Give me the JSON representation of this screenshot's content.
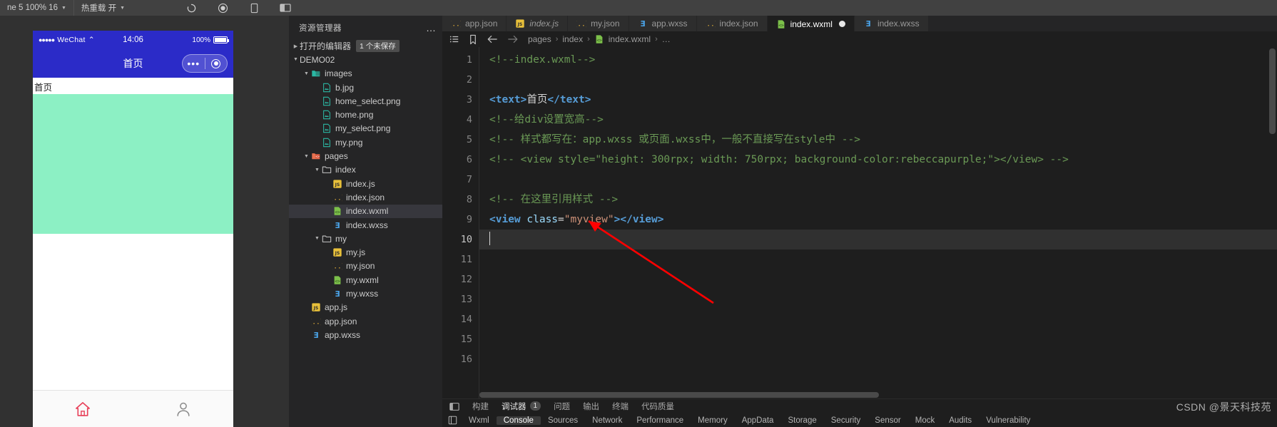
{
  "toolbar": {
    "segments": [
      {
        "name": "device-select",
        "label": "ne 5 100% 16",
        "caret": "▼"
      },
      {
        "name": "hot-reload",
        "label": "热重载 开",
        "caret": "▼"
      }
    ],
    "icons": [
      "refresh-icon",
      "record-icon",
      "mobile-preview-icon",
      "split-panel-icon"
    ]
  },
  "simulator": {
    "status_bar": {
      "carrier": "WeChat",
      "signal_dots": "●●●●●",
      "wifi": "⌃",
      "time": "14:06",
      "battery_text": "100%"
    },
    "nav_title": "首页",
    "capsule": {
      "dots": "•••",
      "circle": "target-icon"
    },
    "page_text": "首页",
    "tabbar": [
      {
        "name": "tab-home",
        "icon": "home-icon"
      },
      {
        "name": "tab-my",
        "icon": "person-icon"
      }
    ]
  },
  "explorer": {
    "title": "资源管理器",
    "more": "…",
    "open_editors": {
      "label": "打开的编辑器",
      "badge": "1 个未保存",
      "twisty": "▶"
    },
    "project": {
      "label": "DEMO02",
      "twisty": "▼"
    },
    "tree": [
      {
        "name": "images",
        "kind": "folder-media",
        "depth": 1,
        "twisty": "▼"
      },
      {
        "name": "b.jpg",
        "kind": "image",
        "depth": 2,
        "twisty": ""
      },
      {
        "name": "home_select.png",
        "kind": "image",
        "depth": 2,
        "twisty": ""
      },
      {
        "name": "home.png",
        "kind": "image",
        "depth": 2,
        "twisty": ""
      },
      {
        "name": "my_select.png",
        "kind": "image",
        "depth": 2,
        "twisty": ""
      },
      {
        "name": "my.png",
        "kind": "image",
        "depth": 2,
        "twisty": ""
      },
      {
        "name": "pages",
        "kind": "folder-pages",
        "depth": 1,
        "twisty": "▼"
      },
      {
        "name": "index",
        "kind": "folder",
        "depth": 2,
        "twisty": "▼"
      },
      {
        "name": "index.js",
        "kind": "js",
        "depth": 3,
        "twisty": ""
      },
      {
        "name": "index.json",
        "kind": "json",
        "depth": 3,
        "twisty": ""
      },
      {
        "name": "index.wxml",
        "kind": "wxml",
        "depth": 3,
        "twisty": "",
        "selected": true
      },
      {
        "name": "index.wxss",
        "kind": "wxss",
        "depth": 3,
        "twisty": ""
      },
      {
        "name": "my",
        "kind": "folder",
        "depth": 2,
        "twisty": "▼"
      },
      {
        "name": "my.js",
        "kind": "js",
        "depth": 3,
        "twisty": ""
      },
      {
        "name": "my.json",
        "kind": "json",
        "depth": 3,
        "twisty": ""
      },
      {
        "name": "my.wxml",
        "kind": "wxml",
        "depth": 3,
        "twisty": ""
      },
      {
        "name": "my.wxss",
        "kind": "wxss",
        "depth": 3,
        "twisty": ""
      },
      {
        "name": "app.js",
        "kind": "js",
        "depth": 1,
        "twisty": ""
      },
      {
        "name": "app.json",
        "kind": "json",
        "depth": 1,
        "twisty": ""
      },
      {
        "name": "app.wxss",
        "kind": "wxss",
        "depth": 1,
        "twisty": ""
      }
    ]
  },
  "editor": {
    "tabs": [
      {
        "label": "app.json",
        "kind": "json",
        "active": false,
        "italic": false,
        "dirty": false
      },
      {
        "label": "index.js",
        "kind": "js",
        "active": false,
        "italic": true,
        "dirty": false
      },
      {
        "label": "my.json",
        "kind": "json",
        "active": false,
        "italic": false,
        "dirty": false
      },
      {
        "label": "app.wxss",
        "kind": "wxss",
        "active": false,
        "italic": false,
        "dirty": false
      },
      {
        "label": "index.json",
        "kind": "json",
        "active": false,
        "italic": false,
        "dirty": false
      },
      {
        "label": "index.wxml",
        "kind": "wxml",
        "active": true,
        "italic": false,
        "dirty": true
      },
      {
        "label": "index.wxss",
        "kind": "wxss",
        "active": false,
        "italic": false,
        "dirty": false
      }
    ],
    "breadcrumb": {
      "icons": [
        "list-icon",
        "bookmark-icon",
        "arrow-left-icon",
        "arrow-right-icon"
      ],
      "path": [
        "pages",
        "index",
        "index.wxml",
        "…"
      ],
      "separator": "›",
      "file_kind": "wxml"
    },
    "line_numbers": [
      "1",
      "2",
      "3",
      "4",
      "5",
      "6",
      "7",
      "8",
      "9",
      "10",
      "11",
      "12",
      "13",
      "14",
      "15",
      "16"
    ],
    "current_line": 10,
    "lines": [
      {
        "n": 1,
        "tokens": [
          {
            "t": "comment",
            "v": "<!--index.wxml-->"
          }
        ]
      },
      {
        "n": 2,
        "tokens": []
      },
      {
        "n": 3,
        "tokens": [
          {
            "t": "tag",
            "v": "<text>"
          },
          {
            "t": "plain",
            "v": "首页"
          },
          {
            "t": "tag",
            "v": "</text>"
          }
        ]
      },
      {
        "n": 4,
        "tokens": [
          {
            "t": "comment",
            "v": "<!--给div设置宽高-->"
          }
        ]
      },
      {
        "n": 5,
        "tokens": [
          {
            "t": "comment",
            "v": "<!-- 样式都写在：app.wxss 或页面.wxss中，一般不直接写在style中 -->"
          }
        ]
      },
      {
        "n": 6,
        "tokens": [
          {
            "t": "comment",
            "v": "<!-- <view style=\"height: 300rpx; width: 750rpx; background-color:rebeccapurple;\"></view> -->"
          }
        ]
      },
      {
        "n": 7,
        "tokens": []
      },
      {
        "n": 8,
        "tokens": [
          {
            "t": "comment",
            "v": "<!-- 在这里引用样式 -->"
          }
        ]
      },
      {
        "n": 9,
        "tokens": [
          {
            "t": "tag",
            "v": "<view "
          },
          {
            "t": "attr",
            "v": "class"
          },
          {
            "t": "plain",
            "v": "="
          },
          {
            "t": "string",
            "v": "\"myview\""
          },
          {
            "t": "tag",
            "v": "></view>"
          }
        ]
      },
      {
        "n": 10,
        "tokens": []
      },
      {
        "n": 11,
        "tokens": []
      },
      {
        "n": 12,
        "tokens": []
      },
      {
        "n": 13,
        "tokens": []
      },
      {
        "n": 14,
        "tokens": []
      },
      {
        "n": 15,
        "tokens": []
      },
      {
        "n": 16,
        "tokens": []
      }
    ]
  },
  "panel": {
    "collapse_icon": "panel-toggle-icon",
    "tabs": [
      {
        "label": "构建",
        "active": false,
        "badge": ""
      },
      {
        "label": "调试器",
        "active": true,
        "badge": "1"
      },
      {
        "label": "问题",
        "active": false,
        "badge": ""
      },
      {
        "label": "输出",
        "active": false,
        "badge": ""
      },
      {
        "label": "终端",
        "active": false,
        "badge": ""
      },
      {
        "label": "代码质量",
        "active": false,
        "badge": ""
      }
    ],
    "devtools_icon": "inspect-icon",
    "devtools_tabs": [
      {
        "label": "Wxml",
        "active": false
      },
      {
        "label": "Console",
        "active": true
      },
      {
        "label": "Sources",
        "active": false
      },
      {
        "label": "Network",
        "active": false
      },
      {
        "label": "Performance",
        "active": false
      },
      {
        "label": "Memory",
        "active": false
      },
      {
        "label": "AppData",
        "active": false
      },
      {
        "label": "Storage",
        "active": false
      },
      {
        "label": "Security",
        "active": false
      },
      {
        "label": "Sensor",
        "active": false
      },
      {
        "label": "Mock",
        "active": false
      },
      {
        "label": "Audits",
        "active": false
      },
      {
        "label": "Vulnerability",
        "active": false
      }
    ]
  },
  "annotation": {
    "arrow_color": "#ff0000"
  },
  "watermark": "CSDN @景天科技苑",
  "colors": {
    "accent_blue": "#2b2bc8",
    "view_green": "#8cf0c4",
    "comment_green": "#6A9955",
    "tag_blue": "#569CD6",
    "string_orange": "#CE9178",
    "attr_lightblue": "#9CDCFE"
  }
}
